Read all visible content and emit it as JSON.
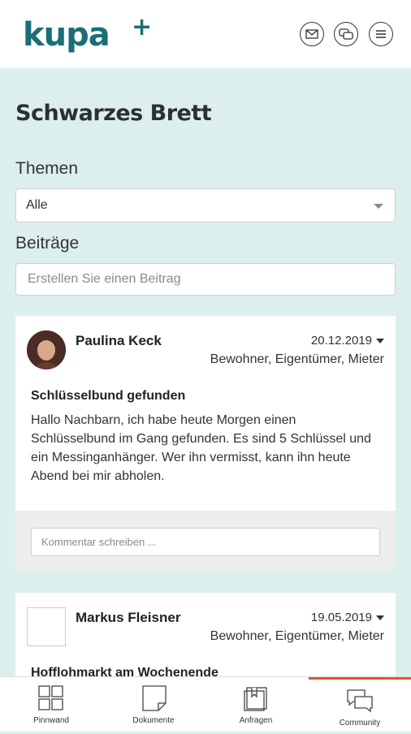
{
  "header": {
    "logo_text": "kupa",
    "logo_plus": "+",
    "icons": [
      "mail-icon",
      "chat-icon",
      "menu-icon"
    ]
  },
  "main": {
    "title": "Schwarzes Brett",
    "topics_label": "Themen",
    "topics_select_value": "Alle",
    "posts_label": "Beiträge",
    "create_post_placeholder": "Erstellen Sie einen Beitrag"
  },
  "posts": [
    {
      "author": "Paulina Keck",
      "date": "20.12.2019",
      "roles": "Bewohner, Eigentümer, Mieter",
      "title": "Schlüsselbund gefunden",
      "body": "Hallo Nachbarn, ich habe heute Morgen einen Schlüsselbund im Gang gefunden. Es sind 5 Schlüssel und ein Messinganhänger. Wer ihn vermisst, kann ihn heute Abend bei mir abholen.",
      "comment_placeholder": "Kommentar schreiben ..."
    },
    {
      "author": "Markus Fleisner",
      "date": "19.05.2019",
      "roles": "Bewohner, Eigentümer, Mieter",
      "title": "Hofflohmarkt am Wochenende"
    }
  ],
  "bottom_nav": {
    "items": [
      {
        "label": "Pinnwand",
        "icon": "grid-icon"
      },
      {
        "label": "Dokumente",
        "icon": "document-icon"
      },
      {
        "label": "Anfragen",
        "icon": "requests-icon"
      },
      {
        "label": "Community",
        "icon": "community-icon"
      }
    ],
    "active": "Community",
    "active_color": "#e0592a"
  },
  "colors": {
    "brand": "#1a6e78",
    "background": "#dcefed"
  }
}
